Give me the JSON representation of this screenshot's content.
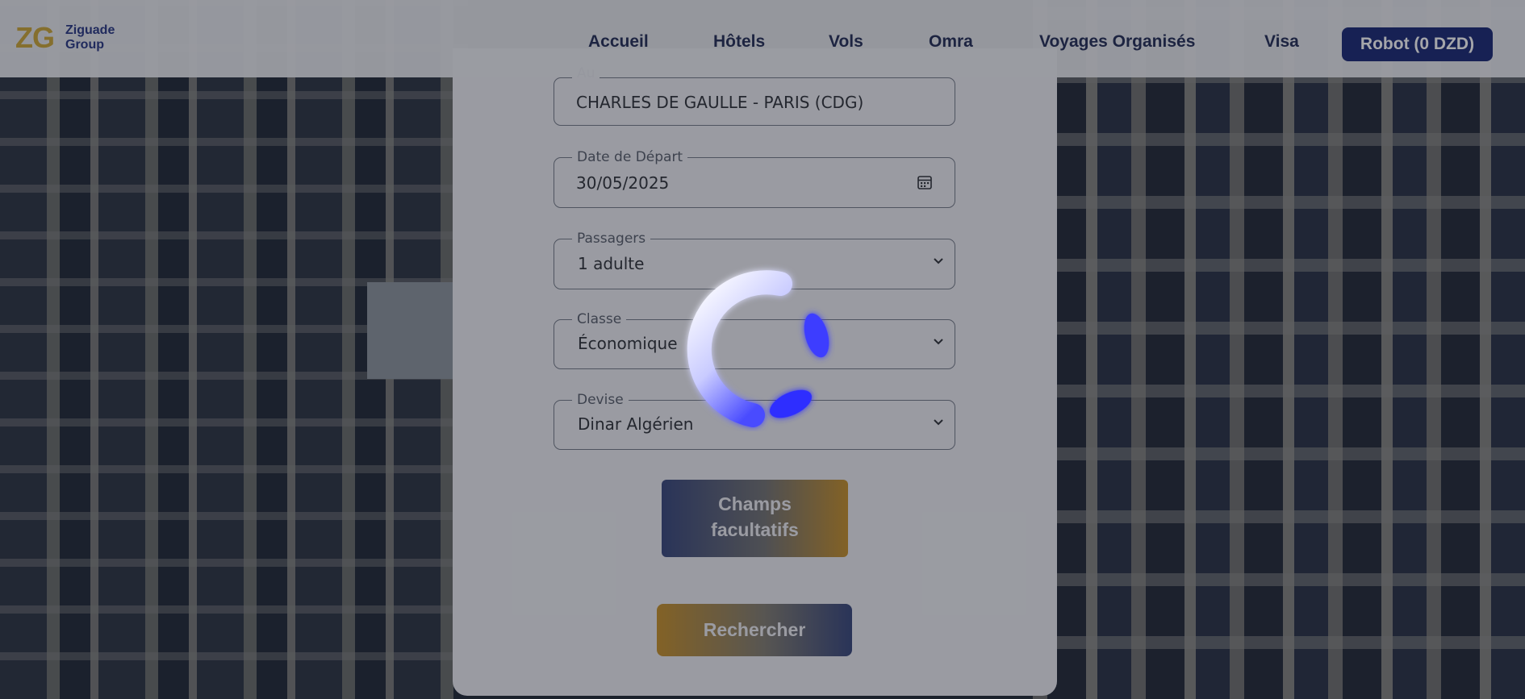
{
  "brand": {
    "logo_mark": "ZG",
    "logo_name": "Ziguade Group",
    "accent_color": "#0b1a6b",
    "gold_color": "#c9a02a"
  },
  "nav": {
    "items": [
      {
        "label": "Accueil"
      },
      {
        "label": "Hôtels"
      },
      {
        "label": "Vols"
      },
      {
        "label": "Omra"
      },
      {
        "label": "Voyages Organisés"
      },
      {
        "label": "Visa"
      }
    ],
    "wallet_button": "Robot (0 DZD)"
  },
  "form": {
    "to": {
      "legend": "Au",
      "value": "CHARLES DE GAULLE - PARIS (CDG)"
    },
    "departure_date": {
      "legend": "Date de Départ",
      "value": "30/05/2025",
      "icon": "calendar-icon"
    },
    "passengers": {
      "legend": "Passagers",
      "value": "1 adulte"
    },
    "class": {
      "legend": "Classe",
      "value": "Économique"
    },
    "currency": {
      "legend": "Devise",
      "value": "Dinar Algérien"
    },
    "optional_fields_button": "Champs facultatifs",
    "search_button": "Rechercher"
  },
  "loading": {
    "icon": "loading-spinner-icon",
    "color": "#3d3dff"
  }
}
